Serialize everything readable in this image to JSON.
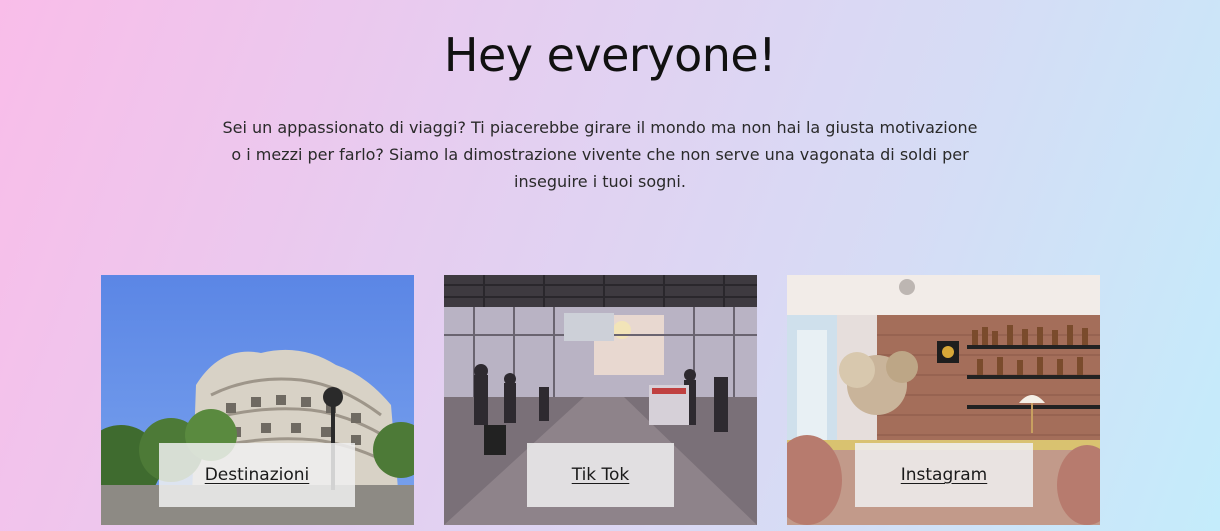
{
  "hero": {
    "title": "Hey everyone!",
    "intro": "Sei un appassionato di viaggi? Ti piacerebbe girare il mondo ma non hai la giusta motivazione o i mezzi per farlo? Siamo la dimostrazione vivente che non serve una vagonata di soldi per inseguire i tuoi sogni."
  },
  "cards": [
    {
      "label": "Destinazioni",
      "image": "building-facade-photo"
    },
    {
      "label": "Tik Tok",
      "image": "airport-terminal-photo"
    },
    {
      "label": "Instagram",
      "image": "cafe-bar-photo"
    }
  ],
  "colors": {
    "gradient_start": "#f9bde9",
    "gradient_end": "#c4ecfb",
    "label_box": "#f0f0f0",
    "text": "#1c1c1c"
  }
}
